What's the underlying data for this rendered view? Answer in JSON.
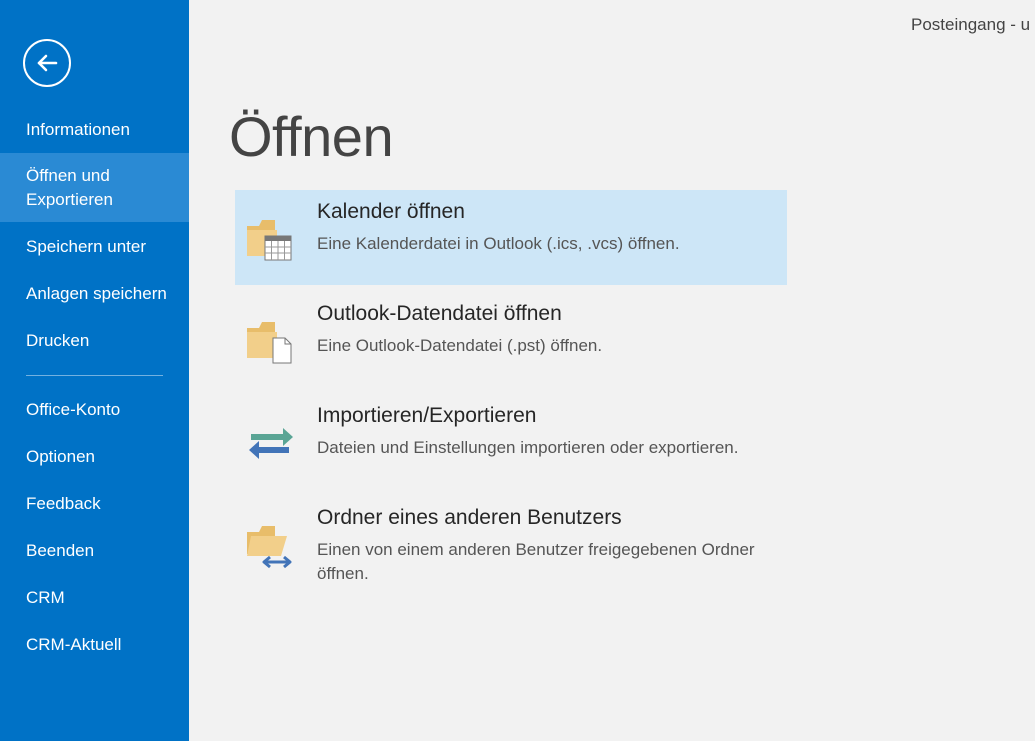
{
  "window": {
    "title": "Posteingang - u"
  },
  "sidebar": {
    "back_icon": "back-arrow-icon",
    "items": [
      {
        "label": "Informationen"
      },
      {
        "label": "Öffnen und Exportieren",
        "selected": true
      },
      {
        "label": "Speichern unter"
      },
      {
        "label": "Anlagen speichern"
      },
      {
        "label": "Drucken"
      },
      {
        "label": "Office-Konto"
      },
      {
        "label": "Optionen"
      },
      {
        "label": "Feedback"
      },
      {
        "label": "Beenden"
      },
      {
        "label": "CRM"
      },
      {
        "label": "CRM-Aktuell"
      }
    ]
  },
  "main": {
    "title": "Öffnen",
    "options": [
      {
        "icon": "folder-calendar-icon",
        "title": "Kalender öffnen",
        "description": "Eine Kalenderdatei in Outlook (.ics, .vcs) öffnen.",
        "selected": true
      },
      {
        "icon": "folder-datafile-icon",
        "title": "Outlook-Datendatei öffnen",
        "description": "Eine Outlook-Datendatei (.pst) öffnen."
      },
      {
        "icon": "import-export-arrows-icon",
        "title": "Importieren/Exportieren",
        "description": "Dateien und Einstellungen importieren oder exportieren."
      },
      {
        "icon": "folder-shared-icon",
        "title": "Ordner eines anderen Benutzers",
        "description": "Einen von einem anderen Benutzer freigegebenen Ordner öffnen."
      }
    ]
  },
  "colors": {
    "sidebar": "#0072c6",
    "sidebar_selected": "#2a8ad4",
    "background": "#f2f2f2",
    "option_selected": "#cde6f7",
    "folder": "#f2cf8a"
  }
}
